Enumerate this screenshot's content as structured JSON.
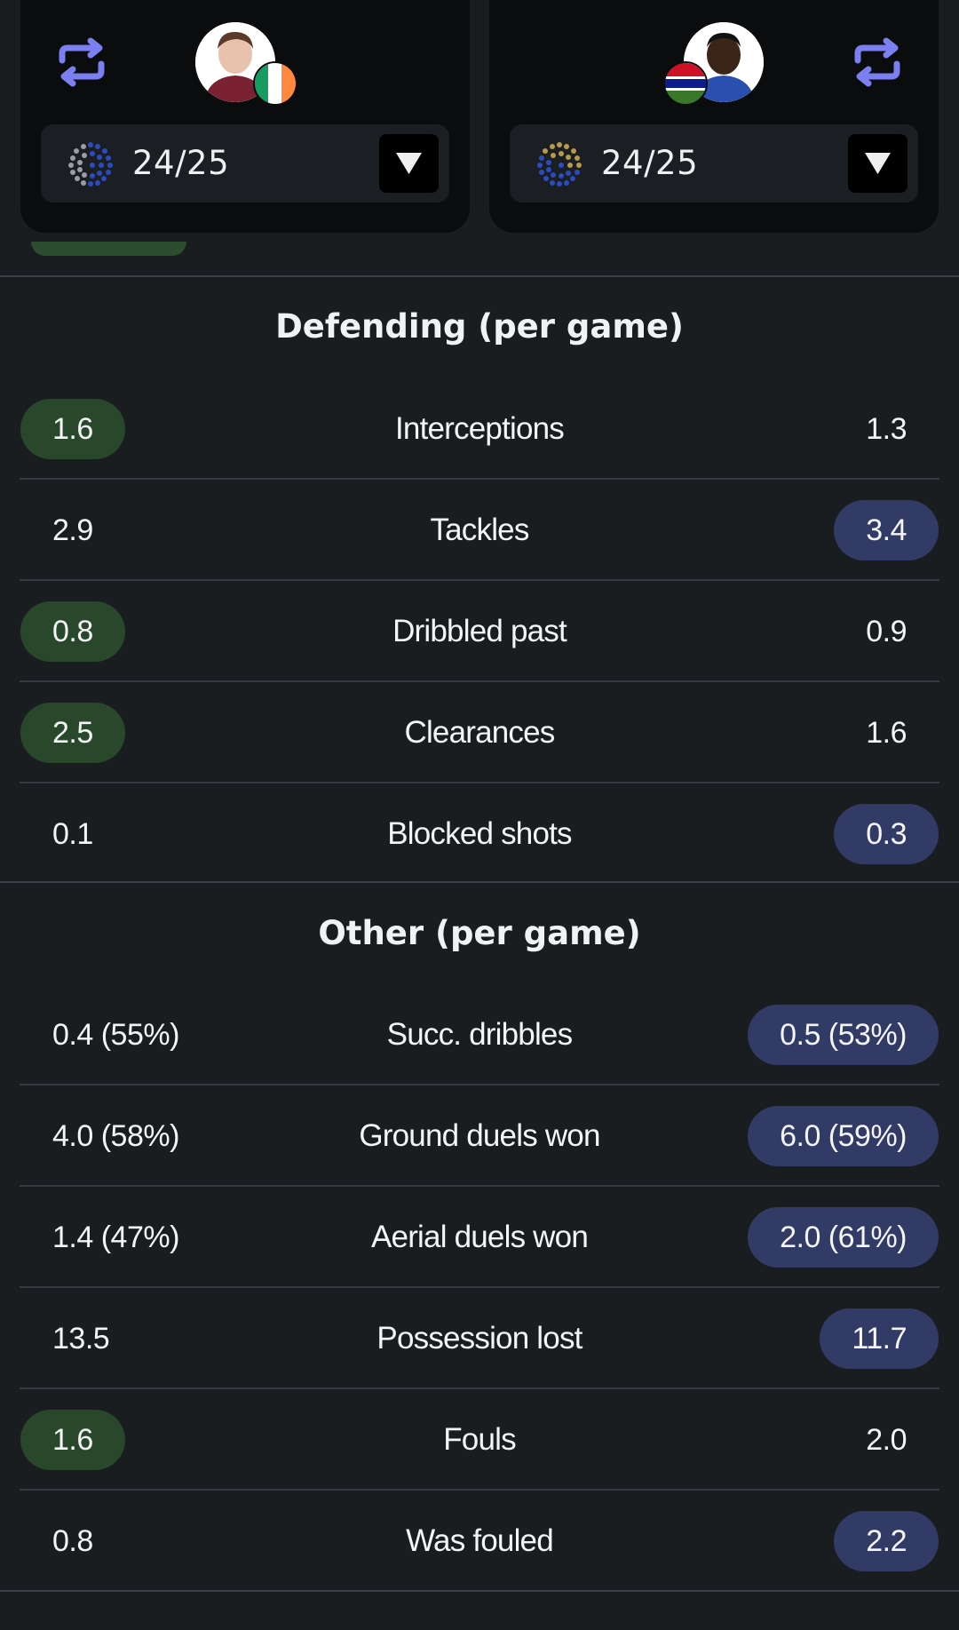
{
  "players": {
    "left": {
      "season": "24/25"
    },
    "right": {
      "season": "24/25"
    }
  },
  "colors": {
    "accent_swap": "#7b7ff0",
    "win_left_pill": "#29472b",
    "win_right_pill": "#323b66"
  },
  "icons": {
    "swap": "swap-arrows-icon",
    "dropdown": "triangle-down-icon"
  },
  "sections": {
    "defending": {
      "title": "Defending (per game)",
      "rows": [
        {
          "label": "Interceptions",
          "left": "1.6",
          "right": "1.3",
          "winner": "left"
        },
        {
          "label": "Tackles",
          "left": "2.9",
          "right": "3.4",
          "winner": "right"
        },
        {
          "label": "Dribbled past",
          "left": "0.8",
          "right": "0.9",
          "winner": "left"
        },
        {
          "label": "Clearances",
          "left": "2.5",
          "right": "1.6",
          "winner": "left"
        },
        {
          "label": "Blocked shots",
          "left": "0.1",
          "right": "0.3",
          "winner": "right"
        }
      ]
    },
    "other": {
      "title": "Other (per game)",
      "rows": [
        {
          "label": "Succ. dribbles",
          "left": "0.4 (55%)",
          "right": "0.5 (53%)",
          "winner": "right"
        },
        {
          "label": "Ground duels won",
          "left": "4.0 (58%)",
          "right": "6.0 (59%)",
          "winner": "right"
        },
        {
          "label": "Aerial duels won",
          "left": "1.4 (47%)",
          "right": "2.0 (61%)",
          "winner": "right"
        },
        {
          "label": "Possession lost",
          "left": "13.5",
          "right": "11.7",
          "winner": "right"
        },
        {
          "label": "Fouls",
          "left": "1.6",
          "right": "2.0",
          "winner": "left"
        },
        {
          "label": "Was fouled",
          "left": "0.8",
          "right": "2.2",
          "winner": "right"
        }
      ]
    }
  }
}
